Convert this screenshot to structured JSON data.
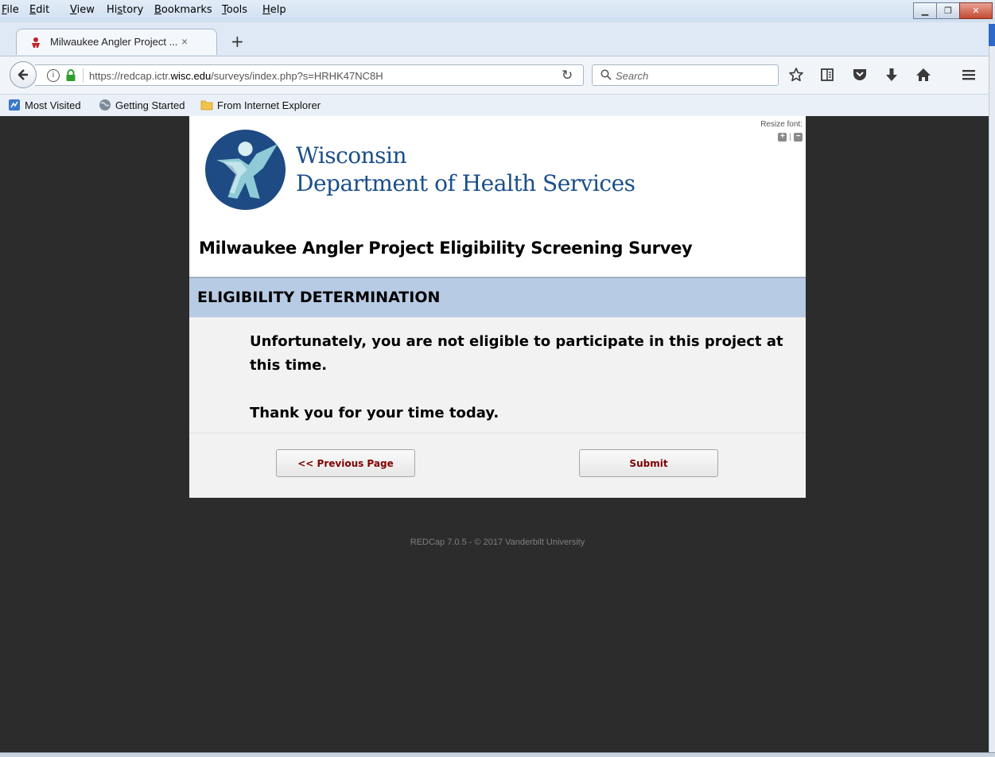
{
  "menubar": {
    "items": [
      "File",
      "Edit",
      "View",
      "History",
      "Bookmarks",
      "Tools",
      "Help"
    ],
    "underline": [
      "F",
      "E",
      "V",
      "s",
      "B",
      "T",
      "H"
    ]
  },
  "tab": {
    "title": "Milwaukee Angler Project ...",
    "close": "×",
    "new_tab": "+"
  },
  "nav": {
    "url_prefix": "https://redcap.ictr.",
    "url_domain": "wisc.edu",
    "url_suffix": "/surveys/index.php?s=HRHK47NC8H",
    "search_placeholder": "Search"
  },
  "bookmarks": [
    "Most Visited",
    "Getting Started",
    "From Internet Explorer"
  ],
  "survey": {
    "org_line1": "Wisconsin",
    "org_line2": "Department of Health Services",
    "resize_font_label": "Resize font:",
    "resize_sep": "|",
    "title": "Milwaukee Angler Project Eligibility Screening Survey",
    "section_header": "ELIGIBILITY DETERMINATION",
    "message_line1": "Unfortunately, you are not eligible to participate in this project at this time.",
    "message_line2": "Thank you for your time today.",
    "prev_button": "<< Previous Page",
    "submit_button": "Submit"
  },
  "footer": "REDCap 7.0.5 - © 2017 Vanderbilt University",
  "colors": {
    "brand_blue": "#1a4f8a",
    "section_bg": "#b8cbe4",
    "button_text": "#800000",
    "page_bg": "#2c2c2c"
  }
}
